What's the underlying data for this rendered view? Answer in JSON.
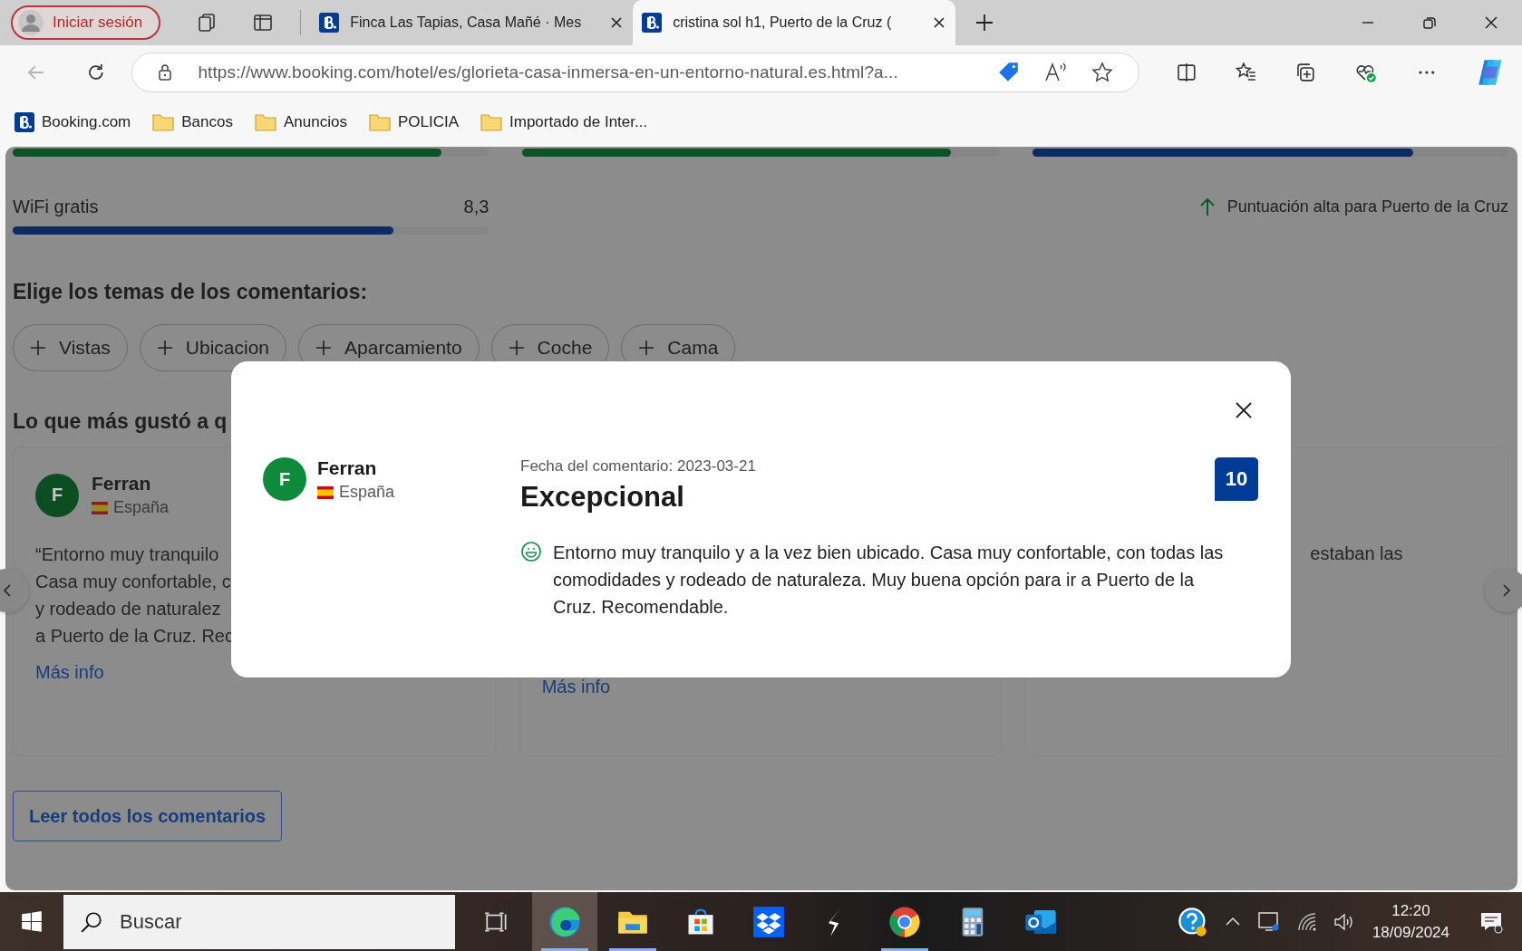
{
  "browser": {
    "profile_button": "Iniciar sesión",
    "tabs": [
      {
        "title": "Finca Las Tapias, Casa Mañé · Mes",
        "selected": false
      },
      {
        "title": "cristina sol h1, Puerto de la Cruz (",
        "selected": true
      }
    ],
    "address": "https://www.booking.com/hotel/es/glorieta-casa-inmersa-en-un-entorno-natural.es.html?a...",
    "bookmarks": [
      {
        "label": "Booking.com",
        "kind": "site"
      },
      {
        "label": "Bancos",
        "kind": "folder"
      },
      {
        "label": "Anuncios",
        "kind": "folder"
      },
      {
        "label": "POLICIA",
        "kind": "folder"
      },
      {
        "label": "Importado de Inter...",
        "kind": "folder"
      }
    ]
  },
  "page": {
    "score_bars": [
      {
        "level": 0.9,
        "color": "#0d5127"
      },
      {
        "level": 0.9,
        "color": "#0d5127"
      },
      {
        "level": 0.8,
        "color": "#0b2a66"
      }
    ],
    "wifi": {
      "label": "WiFi gratis",
      "score": "8,3",
      "level": 0.8,
      "color": "#0b2a66"
    },
    "high_score_note": "Puntuación alta para Puerto de la Cruz",
    "topics_heading": "Elige los temas de los comentarios:",
    "topics": [
      "Vistas",
      "Ubicacion",
      "Aparcamiento",
      "Coche",
      "Cama"
    ],
    "liked_heading": "Lo que más gustó a q",
    "review_cards": [
      {
        "avatar": "F",
        "name": "Ferran",
        "country": "España",
        "quote_lines": [
          "“Entorno muy tranquilo",
          "Casa muy confortable, c",
          "y rodeado de naturalez",
          "a Puerto de la Cruz. Rec"
        ],
        "more": "Más info"
      },
      {
        "more": "Más info"
      },
      {
        "quote_lines": [
          "estaban las"
        ]
      }
    ],
    "read_all_button": "Leer todos los comentarios"
  },
  "modal": {
    "avatar": "F",
    "name": "Ferran",
    "country": "España",
    "date": "Fecha del comentario: 2023-03-21",
    "title": "Excepcional",
    "score": "10",
    "text": "Entorno muy tranquilo y a la vez bien ubicado. Casa muy confortable, con todas las comodidades y rodeado de naturaleza. Muy buena opción para ir a Puerto de la Cruz. Recomendable."
  },
  "taskbar": {
    "search_placeholder": "Buscar",
    "apps": [
      {
        "kind": "taskview",
        "active": false,
        "running": false
      },
      {
        "kind": "edge",
        "active": true,
        "running": true
      },
      {
        "kind": "explorer",
        "active": false,
        "running": true
      },
      {
        "kind": "store",
        "active": false,
        "running": false
      },
      {
        "kind": "dropbox",
        "active": false,
        "running": false
      },
      {
        "kind": "bolt",
        "active": false,
        "running": false
      },
      {
        "kind": "chrome",
        "active": false,
        "running": true
      },
      {
        "kind": "calculator",
        "active": false,
        "running": false
      },
      {
        "kind": "outlook",
        "active": false,
        "running": false
      }
    ],
    "time": "12:20",
    "date": "18/09/2024"
  }
}
